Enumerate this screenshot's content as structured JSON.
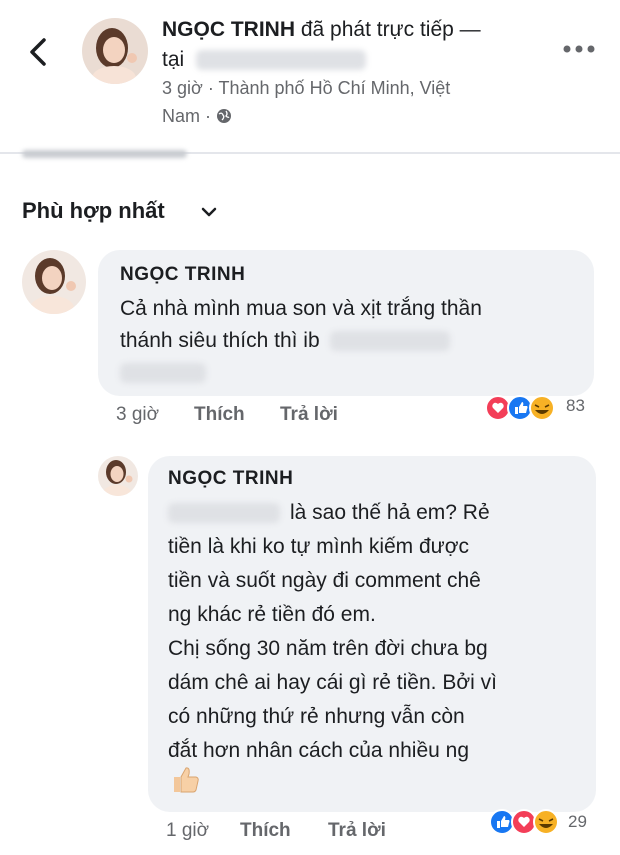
{
  "header": {
    "author": "NGỌC TRINH",
    "action": " đã phát trực tiếp —",
    "at": "tại",
    "time": "3 giờ",
    "sep": " · ",
    "location_line1": "Thành phố Hồ Chí Minh, Việt",
    "location_line2": "Nam",
    "dot": " · ",
    "back_icon": "chevron-left-icon",
    "more_icon": "more-horizontal-icon",
    "globe_icon": "globe-icon"
  },
  "sort": {
    "label": "Phù hợp nhất",
    "caret_icon": "chevron-down-icon"
  },
  "comments": [
    {
      "author": "NGỌC TRINH",
      "lines": [
        "Cả nhà mình mua son và xịt trắng thần",
        "thánh siêu thích thì ib"
      ],
      "time": "3 giờ",
      "like": "Thích",
      "reply": "Trả lời",
      "reactions": [
        "love",
        "like",
        "haha"
      ],
      "reaction_count": "83"
    },
    {
      "author": "NGỌC TRINH",
      "lines": [
        "là sao thế hả em? Rẻ",
        "tiền là khi ko tự mình kiếm được",
        "tiền và suốt ngày đi comment chê",
        "ng khác rẻ tiền đó em.",
        "Chị sống 30 năm trên đời chưa bg",
        "dám chê ai hay cái gì rẻ tiền. Bởi vì",
        "có những thứ rẻ nhưng vẫn còn",
        "đắt hơn nhân cách của nhiều ng"
      ],
      "sticker": "thumbs-up-emoji",
      "time": "1 giờ",
      "like": "Thích",
      "reply": "Trả lời",
      "reactions": [
        "like",
        "love",
        "haha"
      ],
      "reaction_count": "29"
    }
  ],
  "colors": {
    "bubble": "#f0f2f5",
    "meta": "#65676b",
    "like_blue": "#1877f2",
    "love_red": "#f33e58",
    "haha_yellow": "#f7b125"
  }
}
